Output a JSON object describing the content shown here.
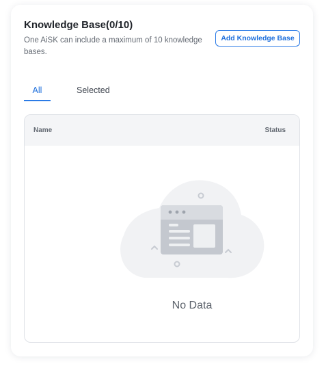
{
  "header": {
    "title": "Knowledge Base(0/10)",
    "description": "One AiSK can include a maximum of 10 knowledge bases.",
    "add_button_label": "Add Knowledge Base"
  },
  "tabs": [
    {
      "label": "All",
      "active": true
    },
    {
      "label": "Selected",
      "active": false
    }
  ],
  "table": {
    "columns": [
      "Name",
      "Status"
    ],
    "rows": [],
    "empty_text": "No Data"
  },
  "colors": {
    "accent": "#2b7be6",
    "text_primary": "#1f2329",
    "text_secondary": "#646a73",
    "header_bg": "#f4f5f7"
  },
  "icons": {
    "empty_state": "empty-document-illustration-icon"
  }
}
